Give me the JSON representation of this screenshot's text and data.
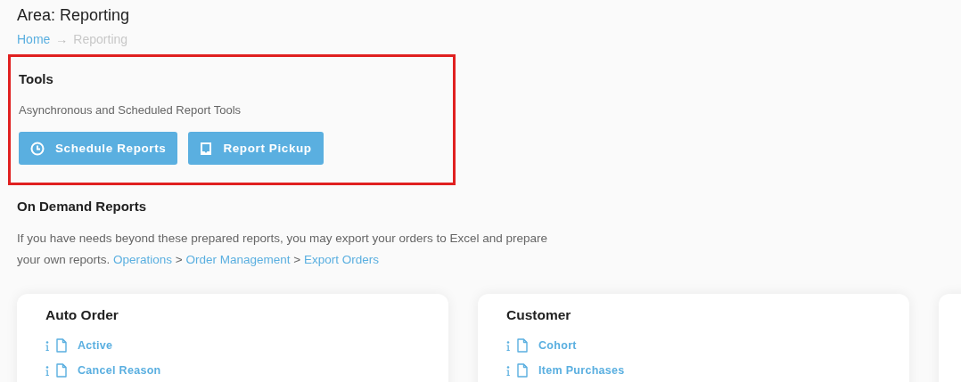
{
  "page": {
    "title": "Area: Reporting"
  },
  "breadcrumb": {
    "separator": "→",
    "items": [
      {
        "label": "Home",
        "current": false
      },
      {
        "label": "Reporting",
        "current": true
      }
    ]
  },
  "tools": {
    "highlighted": true,
    "heading": "Tools",
    "description": "Asynchronous and Scheduled Report Tools",
    "buttons": [
      {
        "label": "Schedule Reports"
      },
      {
        "label": "Report Pickup"
      }
    ]
  },
  "on_demand": {
    "heading": "On Demand Reports",
    "text": "If you have needs beyond these prepared reports, you may export your orders to Excel and prepare your own reports.",
    "separator": ">",
    "path": [
      {
        "label": "Operations"
      },
      {
        "label": "Order Management"
      },
      {
        "label": "Export Orders"
      }
    ]
  },
  "cards": [
    {
      "title": "Auto Order",
      "reports": [
        {
          "label": "Active"
        },
        {
          "label": "Cancel Reason"
        }
      ]
    },
    {
      "title": "Customer",
      "reports": [
        {
          "label": "Cohort"
        },
        {
          "label": "Item Purchases"
        }
      ]
    }
  ]
}
